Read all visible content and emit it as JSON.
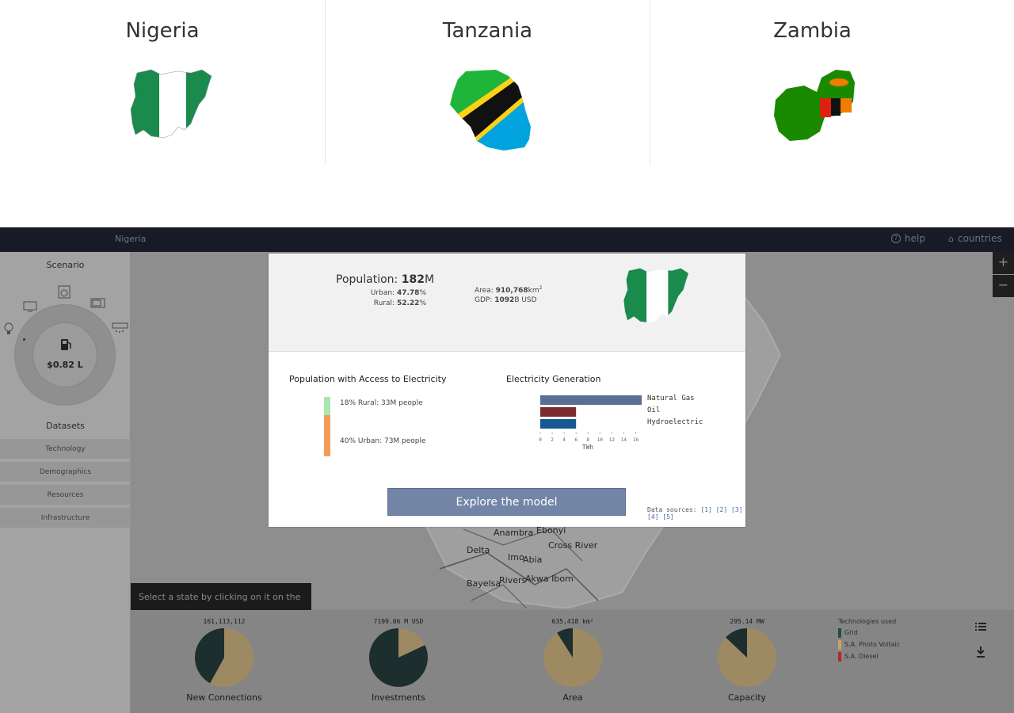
{
  "countries": [
    {
      "name": "Nigeria"
    },
    {
      "name": "Tanzania"
    },
    {
      "name": "Zambia"
    }
  ],
  "app": {
    "title": "Nigeria",
    "help_label": "help",
    "countries_label": "countries"
  },
  "sidebar": {
    "scenario_heading": "Scenario",
    "fuel_price": "$0.82 L",
    "datasets_heading": "Datasets",
    "datasets": [
      "Technology",
      "Demographics",
      "Resources",
      "Infrastructure"
    ]
  },
  "map": {
    "labels": [
      "Anambra",
      "Ebonyi",
      "Cross River",
      "Delta",
      "Imo",
      "Abia",
      "Bayelsa",
      "Rivers",
      "Akwa Ibom"
    ],
    "hint": "Select a state by clicking on it on the map.",
    "zoom_in": "+",
    "zoom_out": "−"
  },
  "stats": [
    {
      "value": "161,113,112",
      "unit": "",
      "label": "New Connections",
      "fraction_dark": 0.42
    },
    {
      "value": "7199.06",
      "unit": "M USD",
      "label": "Investments",
      "fraction_dark": 0.82
    },
    {
      "value": "635,418",
      "unit": "km²",
      "label": "Area",
      "fraction_dark": 0.09
    },
    {
      "value": "295.14",
      "unit": "MW",
      "label": "Capacity",
      "fraction_dark": 0.13
    }
  ],
  "legend": {
    "title": "Technologies used",
    "items": [
      {
        "label": "Grid",
        "color": "#1f4d4a"
      },
      {
        "label": "S.A. Photo Voltaic",
        "color": "#c9a262"
      },
      {
        "label": "S.A. Diesel",
        "color": "#b02a1f"
      }
    ]
  },
  "modal": {
    "population_label": "Population:",
    "population_value": "182",
    "population_unit": "M",
    "urban_label": "Urban:",
    "urban_value": "47.78",
    "rural_label": "Rural:",
    "rural_value": "52.22",
    "percent": "%",
    "area_label": "Area:",
    "area_value": "910,768",
    "area_unit": "km",
    "area_exp": "2",
    "gdp_label": "GDP:",
    "gdp_value": "1092",
    "gdp_unit": "B USD",
    "access_title": "Population with Access to Electricity",
    "access_rural": "18% Rural: 33M people",
    "access_urban": "40% Urban: 73M people",
    "generation_title": "Electricity Generation",
    "explore_label": "Explore the model",
    "sources_label": "Data sources:",
    "sources": [
      "[1]",
      "[2]",
      "[3]",
      "[4]",
      "[5]"
    ]
  },
  "chart_data": {
    "type": "bar",
    "title": "Electricity Generation",
    "xlabel": "TWh",
    "ylabel": "",
    "xlim": [
      0,
      17
    ],
    "ticks": [
      0,
      2,
      4,
      6,
      8,
      10,
      12,
      14,
      16
    ],
    "categories": [
      "Natural Gas",
      "Oil",
      "Hydroelectric"
    ],
    "values": [
      17,
      6,
      6
    ],
    "colors": [
      "#596f94",
      "#7b2d2d",
      "#175a8f"
    ]
  },
  "access_chart": {
    "rural_color": "#a8e6b2",
    "urban_color": "#f39c55",
    "rural_fraction": 0.18,
    "urban_fraction": 0.4
  },
  "colors": {
    "topbar": "#161b26",
    "button": "#7285a6"
  }
}
